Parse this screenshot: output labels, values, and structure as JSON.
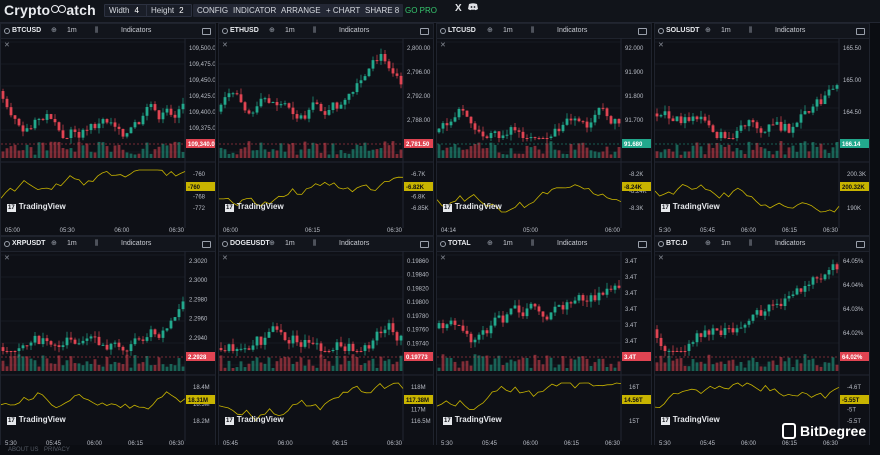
{
  "header": {
    "logo_text": "CryptoWatch",
    "logo_prefix": "Crypto",
    "logo_suffix": "atch",
    "width_label": "Width",
    "width_value": "4",
    "height_label": "Height",
    "height_value": "2",
    "config": "CONFIG",
    "indicator": "INDICATOR",
    "arrange": "ARRANGE",
    "add_chart": "+ CHART",
    "share": "SHARE 8",
    "go_pro": "GO PRO",
    "x_icon": "X",
    "discord_icon": "discord-icon"
  },
  "common": {
    "timeframe": "1m",
    "indicators": "Indicators",
    "tradingview": "TradingView",
    "tv_badge": "17"
  },
  "panels": [
    {
      "symbol": "BTCUSD",
      "yticks": [
        "109,500.0",
        "109,475.0",
        "109,450.0",
        "109,425.0",
        "109,400.0",
        "109,375.0",
        "109,350.0"
      ],
      "price_tag": "109,340.0",
      "price_color": "#e04452",
      "ind_ticks": [
        "-760",
        "-764",
        "-768",
        "-772"
      ],
      "ind_tag": "-760",
      "xticks": [
        "05:00",
        "05:30",
        "06:00",
        "06:30"
      ],
      "seed": 3
    },
    {
      "symbol": "ETHUSD",
      "yticks": [
        "2,800.00",
        "2,796.00",
        "2,792.00",
        "2,788.00",
        "2,784.00"
      ],
      "price_tag": "2,781.50",
      "price_color": "#e04452",
      "ind_ticks": [
        "-6.7K",
        "-6.75K",
        "-6.8K",
        "-6.85K"
      ],
      "ind_tag": "-6.82K",
      "xticks": [
        "06:00",
        "06:15",
        "06:30"
      ],
      "seed": 7
    },
    {
      "symbol": "LTCUSD",
      "yticks": [
        "92.000",
        "91.900",
        "91.800",
        "91.700",
        "91.600"
      ],
      "price_tag": "91.680",
      "price_color": "#22a88c",
      "ind_ticks": [
        "-8.2K",
        "-8.24K",
        "-8.3K"
      ],
      "ind_tag": "-8.24K",
      "xticks": [
        "04:14",
        "05:00",
        "06:00"
      ],
      "seed": 11
    },
    {
      "symbol": "SOLUSDT",
      "yticks": [
        "165.50",
        "165.00",
        "164.50",
        "164.00"
      ],
      "price_tag": "166.14",
      "price_color": "#22a88c",
      "ind_ticks": [
        "200.3K",
        "190K"
      ],
      "ind_tag": "200.32K",
      "xticks": [
        "5:30",
        "05:45",
        "06:00",
        "06:15",
        "06:30"
      ],
      "seed": 19
    },
    {
      "symbol": "XRPUSDT",
      "yticks": [
        "2.3020",
        "2.3000",
        "2.2980",
        "2.2960",
        "2.2940",
        "2.2920"
      ],
      "price_tag": "2.2928",
      "price_color": "#e04452",
      "ind_ticks": [
        "18.4M",
        "18.3M",
        "18.2M"
      ],
      "ind_tag": "18.31M",
      "xticks": [
        "5:30",
        "05:45",
        "06:00",
        "06:15",
        "06:30"
      ],
      "seed": 23
    },
    {
      "symbol": "DOGEUSDT",
      "yticks": [
        "0.19860",
        "0.19840",
        "0.19820",
        "0.19800",
        "0.19780",
        "0.19760",
        "0.19740",
        "0.19720"
      ],
      "price_tag": "0.19773",
      "price_color": "#e04452",
      "ind_ticks": [
        "118M",
        "117.5M",
        "117M",
        "116.5M"
      ],
      "ind_tag": "117.38M",
      "xticks": [
        "05:45",
        "06:00",
        "06:15",
        "06:30"
      ],
      "seed": 29
    },
    {
      "symbol": "TOTAL",
      "yticks": [
        "3.4T",
        "3.4T",
        "3.4T",
        "3.4T",
        "3.4T",
        "3.4T",
        "3.4T"
      ],
      "price_tag": "3.4T",
      "price_color": "#e04452",
      "ind_ticks": [
        "16T",
        "15T"
      ],
      "ind_tag": "14.56T",
      "xticks": [
        "5:30",
        "05:45",
        "06:00",
        "06:15",
        "06:30"
      ],
      "seed": 31
    },
    {
      "symbol": "BTC.D",
      "yticks": [
        "64.05%",
        "64.04%",
        "64.03%",
        "64.02%",
        "64.01%"
      ],
      "price_tag": "64.02%",
      "price_color": "#e04452",
      "ind_ticks": [
        "-4.6T",
        "-4.8T",
        "-5T",
        "-5.5T"
      ],
      "ind_tag": "-5.55T",
      "xticks": [
        "5:30",
        "05:45",
        "06:00",
        "06:15",
        "06:30"
      ],
      "seed": 37
    }
  ],
  "footer": {
    "about": "ABOUT US",
    "privacy": "PRIVACY"
  },
  "watermark": "BitDegree",
  "colors": {
    "up": "#22a88c",
    "down": "#e04452",
    "indicator": "#c8b400",
    "background": "#0e1016"
  }
}
